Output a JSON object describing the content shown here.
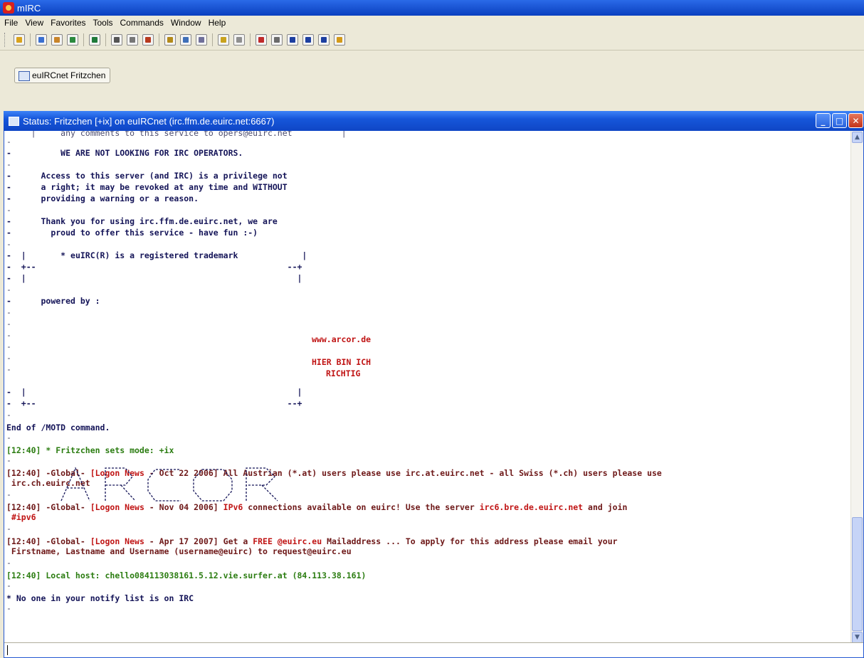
{
  "app": {
    "title": "mIRC"
  },
  "menu": [
    "File",
    "View",
    "Favorites",
    "Tools",
    "Commands",
    "Window",
    "Help"
  ],
  "switchbar": {
    "tab_label": "euIRCnet Fritzchen"
  },
  "status_window": {
    "title": "Status: Fritzchen [+ix] on euIRCnet (irc.ffm.de.euirc.net:6667)",
    "minimize": "_",
    "maximize": "□",
    "close": "✕"
  },
  "motd": {
    "top_cut": "     |     any comments to this service to opers@euirc.net          |",
    "not_looking": "WE ARE NOT LOOKING FOR IRC OPERATORS.",
    "access_1": "Access to this server (and IRC) is a privilege not",
    "access_2": "a right; it may be revoked at any time and WITHOUT",
    "access_3": "providing a warning or a reason.",
    "thanks_1": "Thank you for using irc.ffm.de.euirc.net, we are",
    "thanks_2": "proud to offer this service - have fun :-)",
    "trademark_row": "|       * euIRC(R) is a registered trademark             |",
    "corner_row": "+--                                                   --+",
    "pipe_row": "|                                                       |",
    "powered_by": "powered by :",
    "logo_word": "ARCOR",
    "arcor_url": "www.arcor.de",
    "arcor_slogan_1": "HIER BIN ICH",
    "arcor_slogan_2": "RICHTIG",
    "end": "End of /MOTD command."
  },
  "messages": {
    "mode": "[12:40] * Fritzchen sets mode: +ix",
    "news1_prefix": "[12:40] -Global- ",
    "news1_tag": "[Logon News",
    "news1_rest": " - Oct 22 2006] All Austrian (*.at) users please use irc.at.euirc.net - all Swiss (*.ch) users please use",
    "news1_cont": " irc.ch.euirc.net",
    "news2_prefix": "[12:40] -Global- ",
    "news2_tag": "[Logon News",
    "news2_rest": " - Nov 04 2006] ",
    "news2_ipv6": "IPv6",
    "news2_mid": " connections available on euirc! Use the server ",
    "news2_server": "irc6.bre.de.euirc.net",
    "news2_end": " and join",
    "news2_chan": "#ipv6",
    "news3_prefix": "[12:40] -Global- ",
    "news3_tag": "[Logon News",
    "news3_rest": " - Apr 17 2007] Get a ",
    "news3_free": "FREE @euirc.eu",
    "news3_end": " Mailaddress ... To apply for this address please email your",
    "news3_cont": " Firstname, Lastname and Username (username@euirc) to request@euirc.eu",
    "localhost": "[12:40] Local host: chello084113038161.5.12.vie.surfer.at (84.113.38.161)",
    "notify": "* No one in your notify list is on IRC"
  },
  "colors": {
    "titlebar": "#0a3fbf",
    "nick_green": "#2c7d12",
    "news_maroon": "#6e1818",
    "arcor_red": "#c01414"
  }
}
